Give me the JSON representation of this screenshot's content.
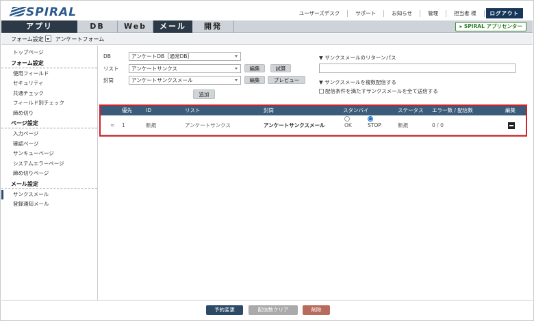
{
  "header": {
    "logo_text": "SPIRAL",
    "links": [
      "ユーザーズデスク",
      "サポート",
      "お知らせ",
      "管理",
      "担当者 様"
    ],
    "logout_label": "ログアウト"
  },
  "nav": {
    "tabs": [
      "アプリ",
      "DB",
      "Web",
      "メール",
      "開発"
    ],
    "active_tab": "メール",
    "app_center_label": "▸ SPIRAL アプリセンター"
  },
  "breadcrumb": {
    "form_settings": "フォーム設定",
    "current": "アンケートフォーム"
  },
  "sidebar": {
    "top_item": "トップページ",
    "sections": [
      {
        "title": "フォーム設定",
        "items": [
          "使用フィールド",
          "セキュリティ",
          "共通チェック",
          "フィールド別チェック",
          "締め切り"
        ]
      },
      {
        "title": "ページ設定",
        "items": [
          "入力ページ",
          "確認ページ",
          "サンキューページ",
          "システムエラーページ",
          "締め切りページ"
        ]
      },
      {
        "title": "メール設定",
        "items": [
          "サンクスメール",
          "登録通知メール"
        ]
      }
    ],
    "active_item": "サンクスメール"
  },
  "form": {
    "db_label": "DB",
    "db_value": "アンケートDB［通常DB］",
    "list_label": "リスト",
    "list_value": "アンケートサンクス",
    "subject_label": "封筒",
    "subject_value": "アンケートサンクスメール",
    "edit_label": "編集",
    "test_label": "試算",
    "preview_label": "プレビュー",
    "add_label": "追加"
  },
  "right_panel": {
    "return_path_title": "▼ サンクスメールのリターンパス",
    "return_path_value": "",
    "multi_title": "▼ サンクスメールを複数配信する",
    "multi_checkbox_label": "配信条件を満たすサンクスメールを全て送信する"
  },
  "table": {
    "headers": [
      "優先",
      "ID",
      "リスト",
      "封筒",
      "スタンバイ",
      "ステータス",
      "エラー数 / 配信数",
      "編集"
    ],
    "rows": [
      {
        "handle": "=",
        "priority": "1",
        "id": "新規",
        "list": "アンケートサンクス",
        "subject": "アンケートサンクスメール",
        "standby_ok": "OK",
        "standby_stop": "STOP",
        "standby_selected": "STOP",
        "status": "新規",
        "counts": "0 / 0"
      }
    ]
  },
  "footer": {
    "reserve_label": "予約変更",
    "clear_label": "配信数クリア",
    "delete_label": "削除"
  },
  "colors": {
    "brand_blue": "#2a5a8c",
    "nav_dark": "#2c3a47",
    "table_header": "#3b5b7a",
    "highlight_red": "#d32027",
    "delete_red": "#b86a5c"
  }
}
